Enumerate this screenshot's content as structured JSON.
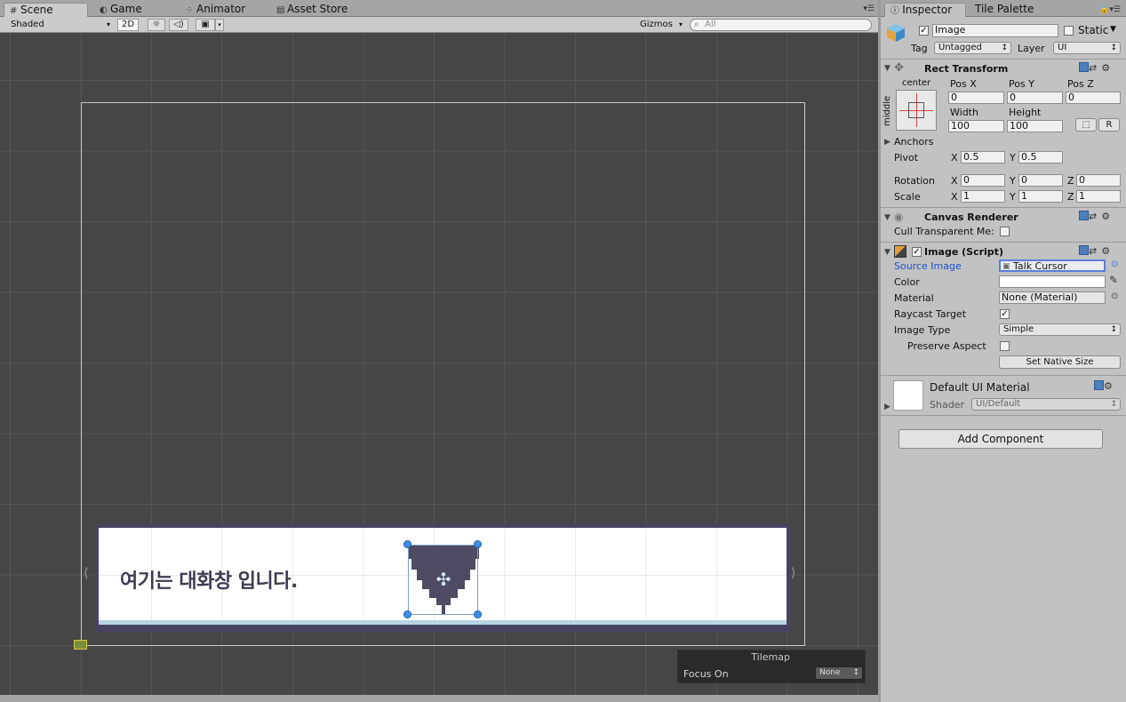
{
  "scene_tabs": [
    {
      "label": "Scene",
      "icon": "#"
    },
    {
      "label": "Game",
      "icon": "◐"
    },
    {
      "label": "Animator",
      "icon": "⁘"
    },
    {
      "label": "Asset Store",
      "icon": "▤"
    }
  ],
  "toolbar": {
    "shading": "Shaded",
    "mode_2d": "2D",
    "light_icon": "☼",
    "audio_icon": "◁)",
    "fx_icon": "▣",
    "gizmos": "Gizmos",
    "search_placeholder": "All"
  },
  "scene": {
    "dialog_text": "여기는 대화창 입니다."
  },
  "tilemap": {
    "title": "Tilemap",
    "focus_label": "Focus On",
    "focus_value": "None"
  },
  "inspector_tabs": [
    {
      "label": "Inspector"
    },
    {
      "label": "Tile Palette"
    }
  ],
  "gameobject": {
    "name": "Image",
    "static_label": "Static",
    "tag_label": "Tag",
    "tag_value": "Untagged",
    "layer_label": "Layer",
    "layer_value": "UI"
  },
  "rect_transform": {
    "title": "Rect Transform",
    "anchor_h": "center",
    "anchor_v": "middle",
    "posx_label": "Pos X",
    "posx": "0",
    "posy_label": "Pos Y",
    "posy": "0",
    "posz_label": "Pos Z",
    "posz": "0",
    "width_label": "Width",
    "width": "100",
    "height_label": "Height",
    "height": "100",
    "r_button": "R",
    "anchors_label": "Anchors",
    "pivot_label": "Pivot",
    "pivot_x": "0.5",
    "pivot_y": "0.5",
    "rotation_label": "Rotation",
    "rot_x": "0",
    "rot_y": "0",
    "rot_z": "0",
    "scale_label": "Scale",
    "scale_x": "1",
    "scale_y": "1",
    "scale_z": "1",
    "x": "X",
    "y": "Y",
    "z": "Z"
  },
  "canvas_renderer": {
    "title": "Canvas Renderer",
    "cull_label": "Cull Transparent Me:"
  },
  "image_script": {
    "title": "Image (Script)",
    "source_label": "Source Image",
    "source_value": "Talk Cursor",
    "color_label": "Color",
    "material_label": "Material",
    "material_value": "None (Material)",
    "raycast_label": "Raycast Target",
    "type_label": "Image Type",
    "type_value": "Simple",
    "preserve_label": "Preserve Aspect",
    "native_button": "Set Native Size"
  },
  "material_preview": {
    "name": "Default UI Material",
    "shader_label": "Shader",
    "shader_value": "UI/Default"
  },
  "add_component": "Add Component",
  "colors": {
    "dialog_border": "#474360",
    "cursor_fill": "#4f4b63",
    "link_blue": "#1d4fd6",
    "selection_handle": "#3c8fe6"
  }
}
